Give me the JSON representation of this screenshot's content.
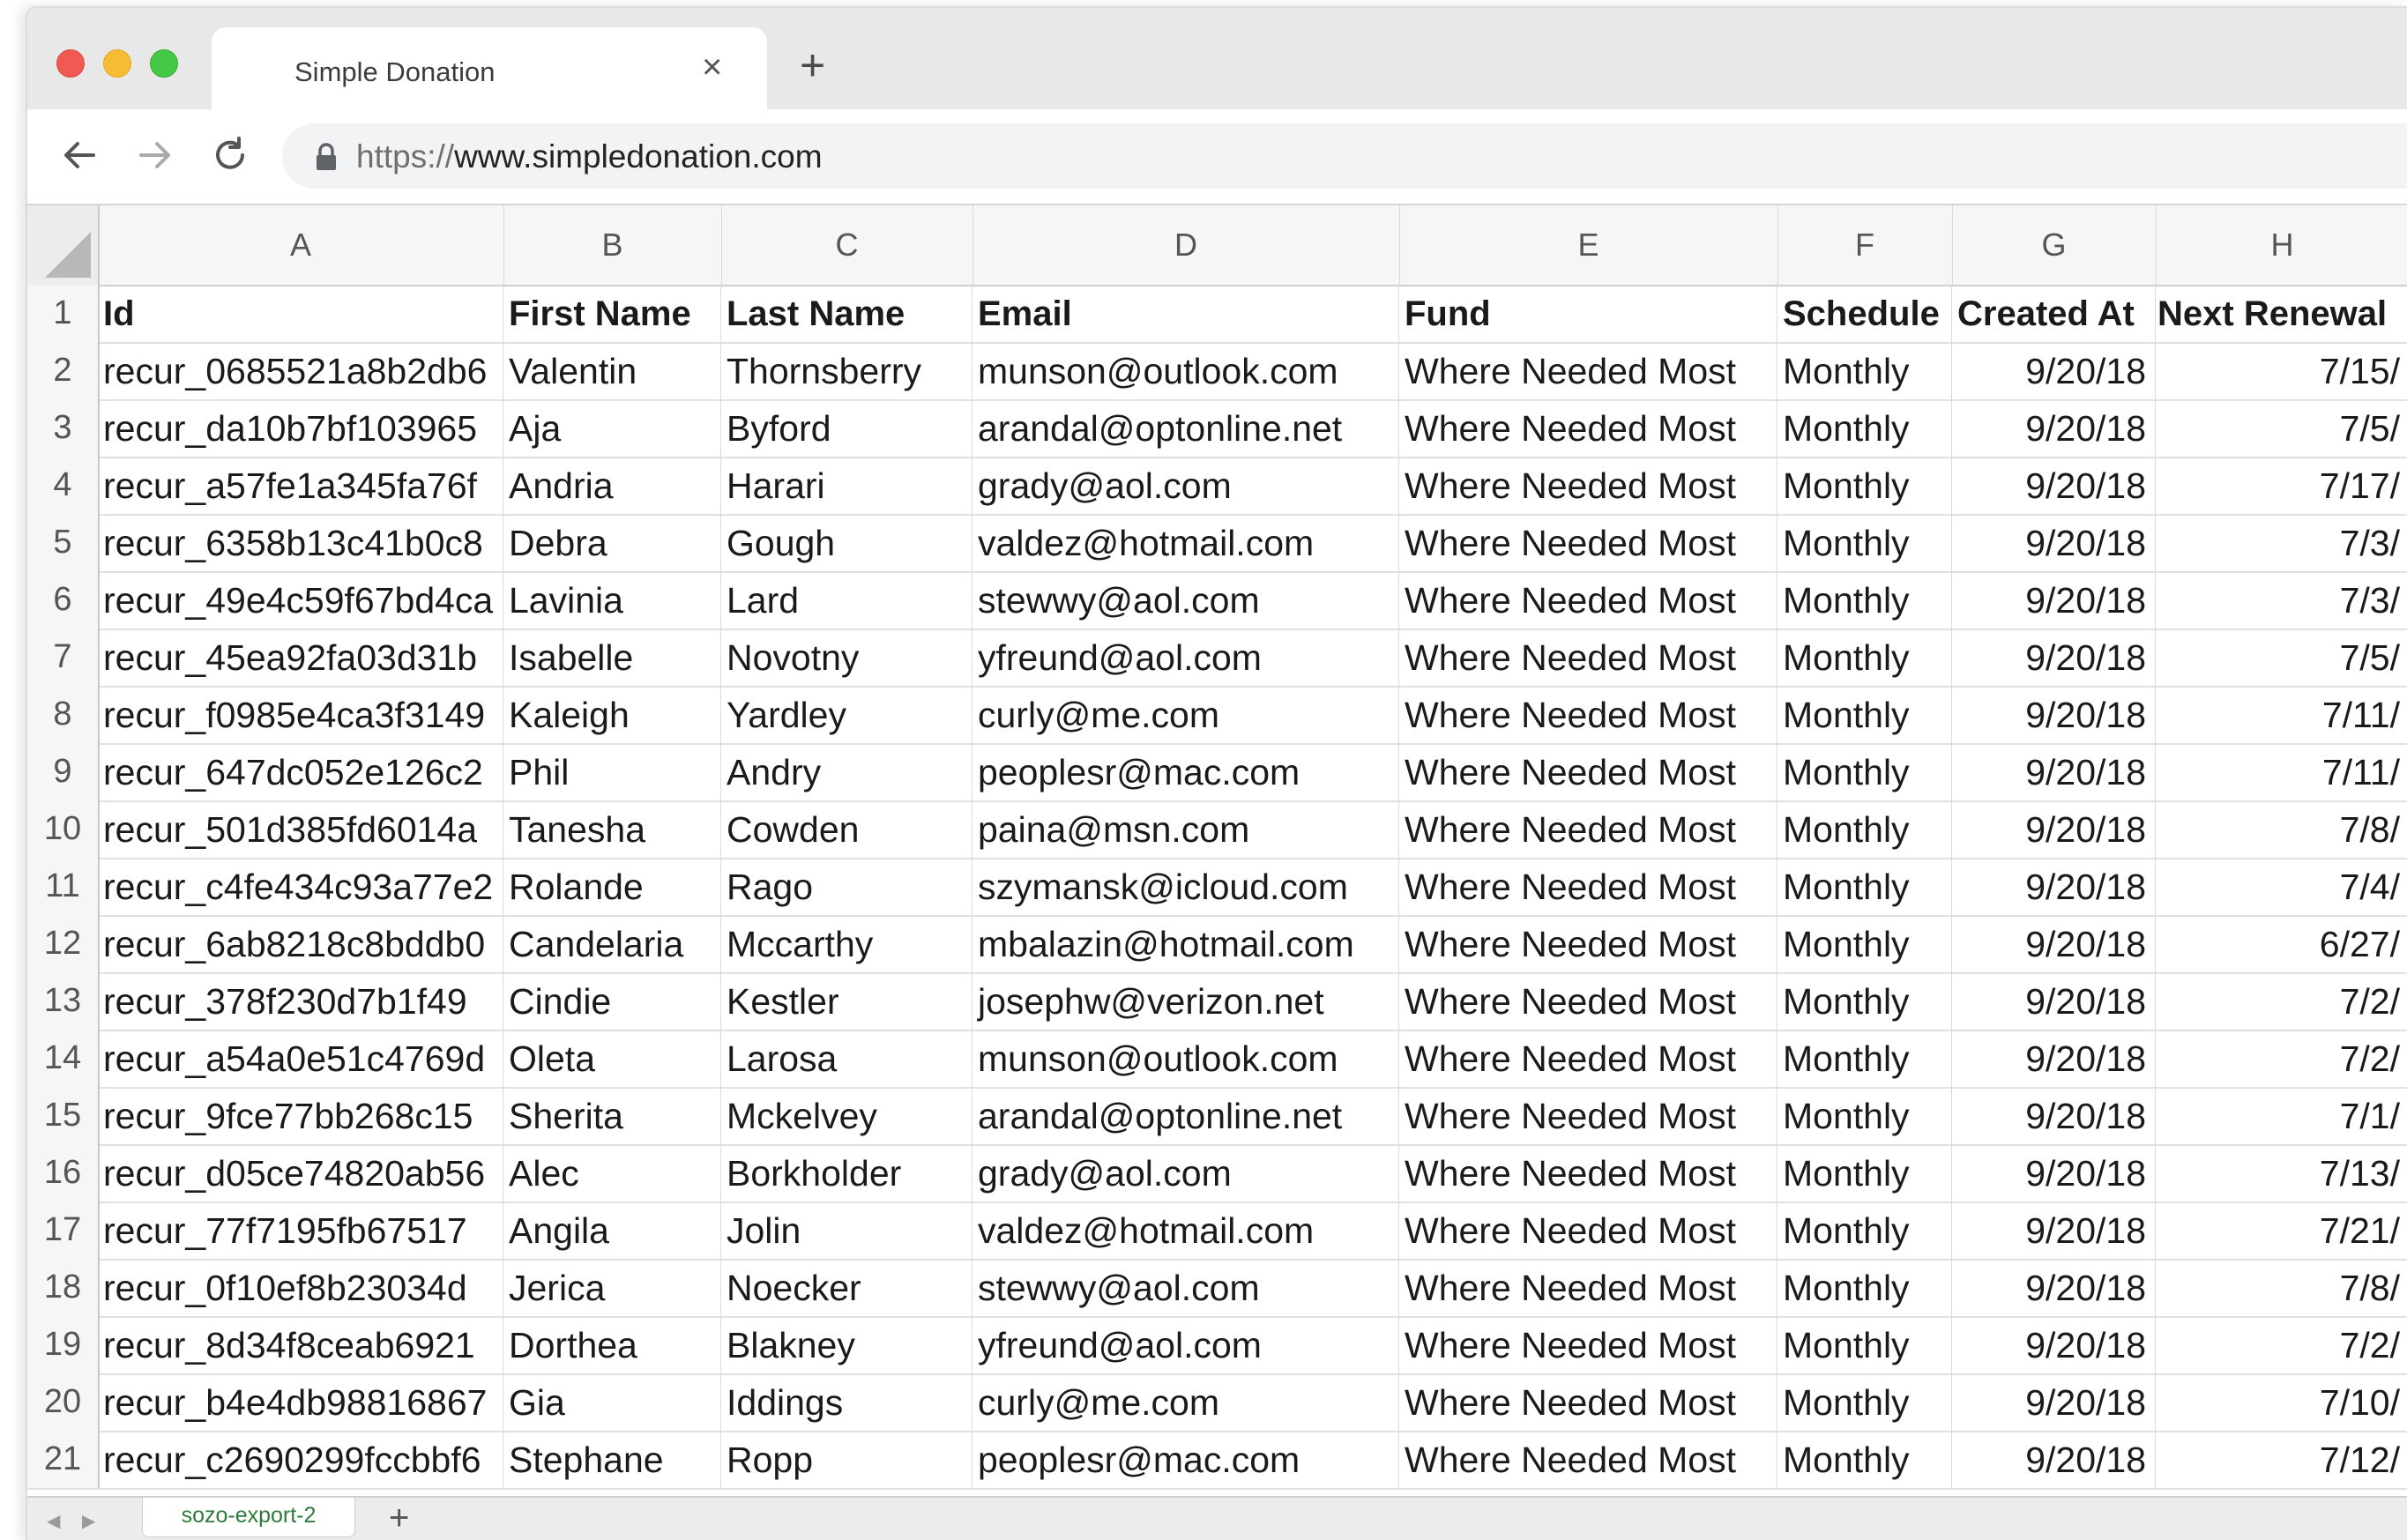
{
  "browser": {
    "tab_title": "Simple Donation",
    "tab_close": "×",
    "new_tab": "+",
    "url_scheme": "https://",
    "url_host": "www.simpledonation.com"
  },
  "spreadsheet": {
    "columns": [
      "A",
      "B",
      "C",
      "D",
      "E",
      "F",
      "G",
      "H"
    ],
    "headers": [
      "Id",
      "First Name",
      "Last Name",
      "Email",
      "Fund",
      "Schedule",
      "Created At",
      "Next Renewal"
    ],
    "rows": [
      {
        "n": "2",
        "id": "recur_0685521a8b2db6",
        "first": "Valentin",
        "last": "Thornsberry",
        "email": "munson@outlook.com",
        "fund": "Where Needed Most",
        "schedule": "Monthly",
        "created": "9/20/18",
        "renewal": "7/15/"
      },
      {
        "n": "3",
        "id": "recur_da10b7bf103965",
        "first": "Aja",
        "last": "Byford",
        "email": "arandal@optonline.net",
        "fund": "Where Needed Most",
        "schedule": "Monthly",
        "created": "9/20/18",
        "renewal": "7/5/"
      },
      {
        "n": "4",
        "id": "recur_a57fe1a345fa76f",
        "first": "Andria",
        "last": "Harari",
        "email": "grady@aol.com",
        "fund": "Where Needed Most",
        "schedule": "Monthly",
        "created": "9/20/18",
        "renewal": "7/17/"
      },
      {
        "n": "5",
        "id": "recur_6358b13c41b0c8",
        "first": "Debra",
        "last": "Gough",
        "email": "valdez@hotmail.com",
        "fund": "Where Needed Most",
        "schedule": "Monthly",
        "created": "9/20/18",
        "renewal": "7/3/"
      },
      {
        "n": "6",
        "id": "recur_49e4c59f67bd4ca",
        "first": "Lavinia",
        "last": "Lard",
        "email": "stewwy@aol.com",
        "fund": "Where Needed Most",
        "schedule": "Monthly",
        "created": "9/20/18",
        "renewal": "7/3/"
      },
      {
        "n": "7",
        "id": "recur_45ea92fa03d31b",
        "first": "Isabelle",
        "last": "Novotny",
        "email": "yfreund@aol.com",
        "fund": "Where Needed Most",
        "schedule": "Monthly",
        "created": "9/20/18",
        "renewal": "7/5/"
      },
      {
        "n": "8",
        "id": "recur_f0985e4ca3f3149",
        "first": "Kaleigh",
        "last": "Yardley",
        "email": "curly@me.com",
        "fund": "Where Needed Most",
        "schedule": "Monthly",
        "created": "9/20/18",
        "renewal": "7/11/"
      },
      {
        "n": "9",
        "id": "recur_647dc052e126c2",
        "first": "Phil",
        "last": "Andry",
        "email": "peoplesr@mac.com",
        "fund": "Where Needed Most",
        "schedule": "Monthly",
        "created": "9/20/18",
        "renewal": "7/11/"
      },
      {
        "n": "10",
        "id": "recur_501d385fd6014a",
        "first": "Tanesha",
        "last": "Cowden",
        "email": "paina@msn.com",
        "fund": "Where Needed Most",
        "schedule": "Monthly",
        "created": "9/20/18",
        "renewal": "7/8/"
      },
      {
        "n": "11",
        "id": "recur_c4fe434c93a77e2",
        "first": "Rolande",
        "last": "Rago",
        "email": "szymansk@icloud.com",
        "fund": "Where Needed Most",
        "schedule": "Monthly",
        "created": "9/20/18",
        "renewal": "7/4/"
      },
      {
        "n": "12",
        "id": "recur_6ab8218c8bddb0",
        "first": "Candelaria",
        "last": "Mccarthy",
        "email": "mbalazin@hotmail.com",
        "fund": "Where Needed Most",
        "schedule": "Monthly",
        "created": "9/20/18",
        "renewal": "6/27/"
      },
      {
        "n": "13",
        "id": "recur_378f230d7b1f49",
        "first": "Cindie",
        "last": "Kestler",
        "email": "josephw@verizon.net",
        "fund": "Where Needed Most",
        "schedule": "Monthly",
        "created": "9/20/18",
        "renewal": "7/2/"
      },
      {
        "n": "14",
        "id": "recur_a54a0e51c4769d",
        "first": "Oleta",
        "last": "Larosa",
        "email": "munson@outlook.com",
        "fund": "Where Needed Most",
        "schedule": "Monthly",
        "created": "9/20/18",
        "renewal": "7/2/"
      },
      {
        "n": "15",
        "id": "recur_9fce77bb268c15",
        "first": "Sherita",
        "last": "Mckelvey",
        "email": "arandal@optonline.net",
        "fund": "Where Needed Most",
        "schedule": "Monthly",
        "created": "9/20/18",
        "renewal": "7/1/"
      },
      {
        "n": "16",
        "id": "recur_d05ce74820ab56",
        "first": "Alec",
        "last": "Borkholder",
        "email": "grady@aol.com",
        "fund": "Where Needed Most",
        "schedule": "Monthly",
        "created": "9/20/18",
        "renewal": "7/13/"
      },
      {
        "n": "17",
        "id": "recur_77f7195fb67517",
        "first": "Angila",
        "last": "Jolin",
        "email": "valdez@hotmail.com",
        "fund": "Where Needed Most",
        "schedule": "Monthly",
        "created": "9/20/18",
        "renewal": "7/21/"
      },
      {
        "n": "18",
        "id": "recur_0f10ef8b23034d",
        "first": "Jerica",
        "last": "Noecker",
        "email": "stewwy@aol.com",
        "fund": "Where Needed Most",
        "schedule": "Monthly",
        "created": "9/20/18",
        "renewal": "7/8/"
      },
      {
        "n": "19",
        "id": "recur_8d34f8ceab6921",
        "first": "Dorthea",
        "last": "Blakney",
        "email": "yfreund@aol.com",
        "fund": "Where Needed Most",
        "schedule": "Monthly",
        "created": "9/20/18",
        "renewal": "7/2/"
      },
      {
        "n": "20",
        "id": "recur_b4e4db98816867",
        "first": "Gia",
        "last": "Iddings",
        "email": "curly@me.com",
        "fund": "Where Needed Most",
        "schedule": "Monthly",
        "created": "9/20/18",
        "renewal": "7/10/"
      },
      {
        "n": "21",
        "id": "recur_c2690299fccbbf6",
        "first": "Stephane",
        "last": "Ropp",
        "email": "peoplesr@mac.com",
        "fund": "Where Needed Most",
        "schedule": "Monthly",
        "created": "9/20/18",
        "renewal": "7/12/"
      }
    ],
    "sheet_tab": "sozo-export-2",
    "add_sheet": "+"
  }
}
